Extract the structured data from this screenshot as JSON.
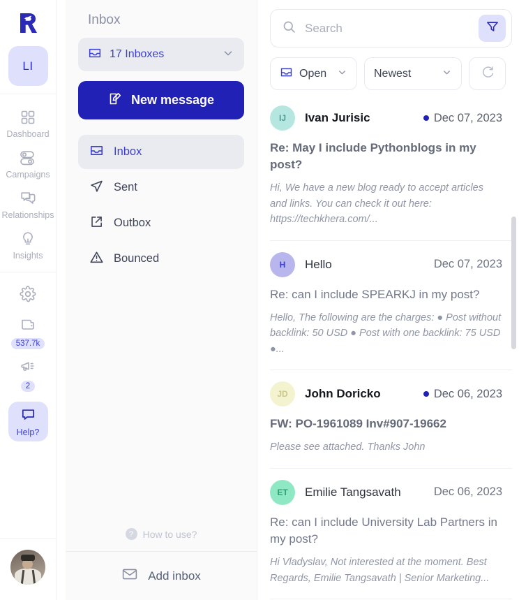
{
  "rail": {
    "logo_name": "rocket-r-logo",
    "org_initials": "LI",
    "nav": [
      {
        "label": "Dashboard",
        "icon": "dashboard-grid-icon"
      },
      {
        "label": "Campaigns",
        "icon": "campaigns-toggle-icon"
      },
      {
        "label": "Relationships",
        "icon": "relationships-chat-icon"
      },
      {
        "label": "Insights",
        "icon": "insights-bulb-icon"
      }
    ],
    "settings_icon": "gear-icon",
    "credits_icon": "credits-folder-icon",
    "credits_badge": "537.7k",
    "announcements_icon": "megaphone-icon",
    "announcements_badge": "2",
    "help_icon": "chat-bubble-icon",
    "help_label": "Help?",
    "avatar_name": "user-profile-photo"
  },
  "inbox_panel": {
    "title": "Inbox",
    "inbox_selector": {
      "label": "17 Inboxes",
      "icon": "inbox-tray-icon",
      "chevron": "chevron-down-icon"
    },
    "new_message_button": {
      "label": "New message",
      "icon": "compose-pencil-icon"
    },
    "folders": [
      {
        "label": "Inbox",
        "icon": "inbox-tray-icon",
        "active": true
      },
      {
        "label": "Sent",
        "icon": "send-paperplane-icon",
        "active": false
      },
      {
        "label": "Outbox",
        "icon": "external-link-arrow-icon",
        "active": false
      },
      {
        "label": "Bounced",
        "icon": "warning-triangle-icon",
        "active": false
      }
    ],
    "how_to_use": "How to use?",
    "add_inbox": {
      "label": "Add inbox",
      "icon": "envelope-icon"
    }
  },
  "list_panel": {
    "search": {
      "placeholder": "Search",
      "value": "",
      "icon": "search-icon"
    },
    "filter_button_icon": "funnel-filter-icon",
    "status_filter": {
      "label": "Open",
      "icon": "inbox-tray-icon",
      "chevron": "chevron-down-icon"
    },
    "sort_filter": {
      "label": "Newest",
      "chevron": "chevron-down-icon"
    },
    "refresh_icon": "refresh-icon",
    "messages": [
      {
        "sender": "Ivan Jurisic",
        "initials": "IJ",
        "avatar_bg": "#b5e7e0",
        "avatar_fg": "#4f9b92",
        "date": "Dec 07, 2023",
        "unread": true,
        "subject": "Re: May I include Pythonblogs in my post?",
        "preview": "Hi, We have a new blog ready to accept articles and links. You can check it out here: https://techkhera.com/..."
      },
      {
        "sender": "Hello",
        "initials": "H",
        "avatar_bg": "#b8b6ec",
        "avatar_fg": "#3b3fd1",
        "date": "Dec 07, 2023",
        "unread": false,
        "subject": "Re: can I include SPEARKJ in my post?",
        "preview": "Hello, The following are the charges: ● Post without backlink: 50 USD ● Post with one backlink: 75 USD ●..."
      },
      {
        "sender": "John Doricko",
        "initials": "JD",
        "avatar_bg": "#f4f3cf",
        "avatar_fg": "#c9c78e",
        "date": "Dec 06, 2023",
        "unread": true,
        "subject": "FW: PO-1961089 Inv#907-19662",
        "preview": "Please see attached. Thanks John"
      },
      {
        "sender": "Emilie Tangsavath",
        "initials": "ET",
        "avatar_bg": "#8fe8c4",
        "avatar_fg": "#2f9e72",
        "date": "Dec 06, 2023",
        "unread": false,
        "subject": "Re: can I include University Lab Partners in my post?",
        "preview": "Hi Vladyslav, Not interested at the moment. Best Regards, Emilie Tangsavath | Senior Marketing..."
      }
    ]
  },
  "colors": {
    "brand_indigo": "#2121b5",
    "accent_lavender": "#dfe0fb",
    "panel_bg": "#fafafb",
    "muted_text": "#a9adbd"
  }
}
